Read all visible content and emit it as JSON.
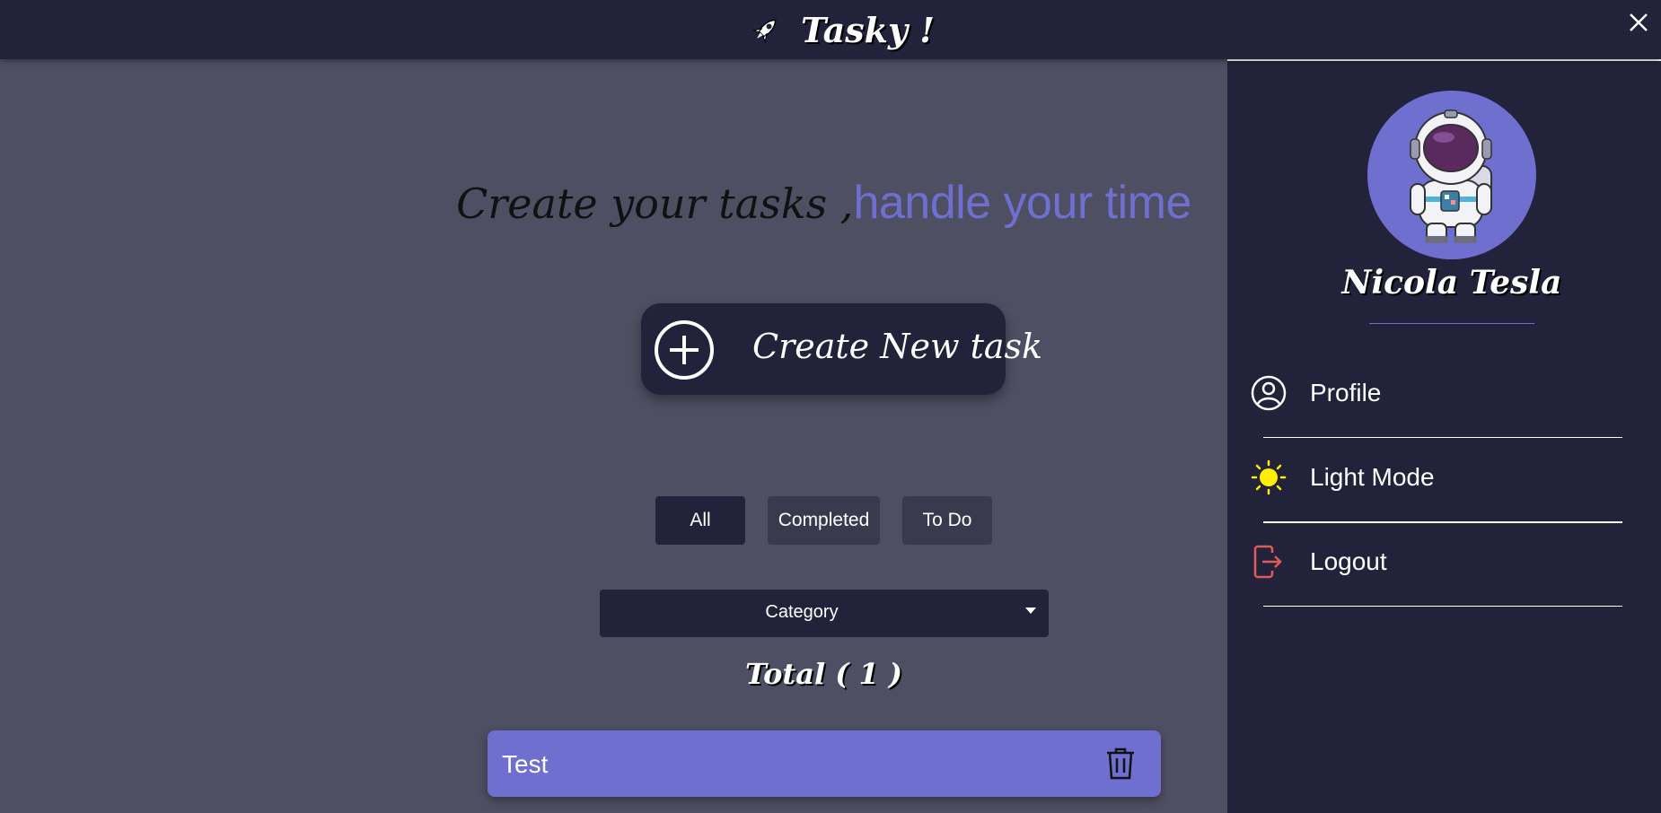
{
  "header": {
    "title": "Tasky !",
    "logo_icon": "rocket-icon",
    "close_icon": "close-icon"
  },
  "main": {
    "headline_script": "Create your tasks ,",
    "headline_accent": "handle your time",
    "create_button_label": "Create New task",
    "filters": [
      "All",
      "Completed",
      "To Do"
    ],
    "category_select": "Category",
    "total_label": "Total ( 1 )",
    "tasks": [
      {
        "title": "Test"
      }
    ]
  },
  "sidebar": {
    "user_name": "Nicola Tesla",
    "avatar": "astronaut-avatar",
    "menu": [
      {
        "label": "Profile",
        "icon": "user-circle-icon"
      },
      {
        "label": "Light Mode",
        "icon": "sun-icon"
      },
      {
        "label": "Logout",
        "icon": "logout-icon"
      }
    ]
  },
  "colors": {
    "background": "#4e4f62",
    "dark_panel": "#22223b",
    "accent": "#6f6fcf",
    "sun": "#ffee00",
    "logout": "#e05a5a"
  }
}
